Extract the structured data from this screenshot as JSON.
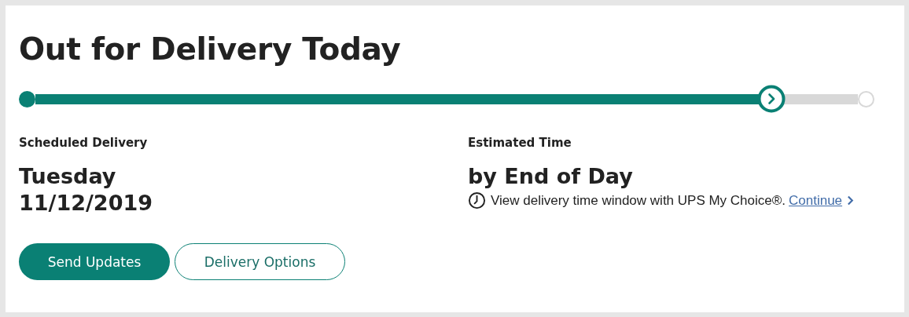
{
  "heading": "Out for Delivery Today",
  "progress": {
    "level": 0.895
  },
  "scheduled": {
    "label": "Scheduled Delivery",
    "day": "Tuesday",
    "date": "11/12/2019"
  },
  "estimated": {
    "label": "Estimated Time",
    "value": "by End of Day",
    "note": "View delivery time window with UPS My Choice®.",
    "link": "Continue"
  },
  "buttons": [
    {
      "label": "Send Updates",
      "kind": "primary"
    },
    {
      "label": "Delivery Options",
      "kind": "outline"
    }
  ]
}
